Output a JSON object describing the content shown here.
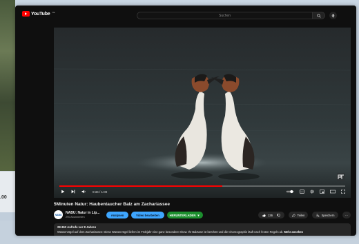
{
  "background": {
    "number_text": ".00"
  },
  "topbar": {
    "logo_text": "YouTube",
    "logo_country": "DE",
    "search_placeholder": "Suchen"
  },
  "player": {
    "time": "0:34 / 1:00",
    "progress_fraction": 0.57
  },
  "video": {
    "title": "5Minuten Natur: Haubentaucher Balz am Zachariassee"
  },
  "channel": {
    "avatar_text": "NABU",
    "name": "NABU: Natur in Lip...",
    "subscribers": "290 Abonnenten"
  },
  "buttons": {
    "analytics": "Analysen",
    "edit_video": "Video bearbeiten",
    "download": "HERUNTERLADEN",
    "likes": "136",
    "share": "Teilen",
    "save": "Speichern",
    "more": "···"
  },
  "description": {
    "meta": "28.363 Aufrufe  vor 8 Jahren",
    "text": "Wasservögel auf dem Zachariassee: Diese Wasservögel liefern im Frühjahr eine ganz besondere Show. Ihr Balztanz ist berühmt und die Choreographie läuft nach festen Regeln ab.",
    "more_label": "Mehr ansehen"
  },
  "colors": {
    "brand_red": "#ff0000",
    "page_bg": "#0f0f0f",
    "blue_button": "#3ea6ff",
    "green_button": "#1c8f2e"
  }
}
